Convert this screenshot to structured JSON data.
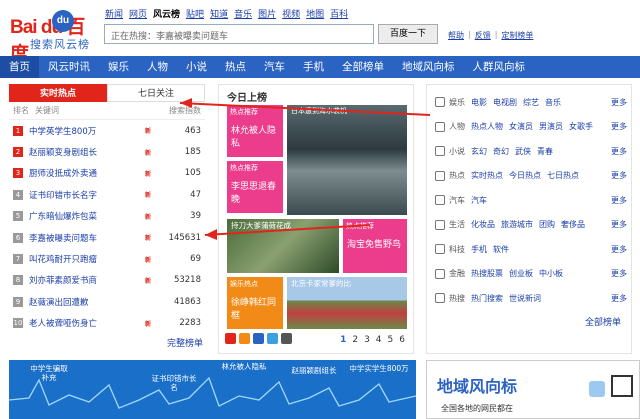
{
  "header": {
    "logo_text": "Bai du 百度",
    "logo_sub": "搜索风云榜",
    "logo_badge": "du",
    "top_links": [
      {
        "label": "新闻",
        "current": false
      },
      {
        "label": "网页",
        "current": false
      },
      {
        "label": "风云榜",
        "current": true
      },
      {
        "label": "贴吧",
        "current": false
      },
      {
        "label": "知道",
        "current": false
      },
      {
        "label": "音乐",
        "current": false
      },
      {
        "label": "图片",
        "current": false
      },
      {
        "label": "视频",
        "current": false
      },
      {
        "label": "地图",
        "current": false
      },
      {
        "label": "百科",
        "current": false
      }
    ],
    "search_value": "正在热搜：李嘉被曝卖问题车",
    "search_button": "百度一下",
    "help_links": [
      "帮助",
      "反馈",
      "定制榜单"
    ],
    "help_sep": "|"
  },
  "nav": {
    "items": [
      {
        "label": "首页",
        "active": true
      },
      {
        "label": "风云时讯",
        "active": false
      },
      {
        "label": "娱乐",
        "active": false
      },
      {
        "label": "人物",
        "active": false
      },
      {
        "label": "小说",
        "active": false
      },
      {
        "label": "热点",
        "active": false
      },
      {
        "label": "汽车",
        "active": false
      },
      {
        "label": "手机",
        "active": false
      },
      {
        "label": "全部榜单",
        "active": false
      },
      {
        "label": "地域风向标",
        "active": false
      },
      {
        "label": "人群风向标",
        "active": false
      }
    ]
  },
  "hot": {
    "tab_active": "实时热点",
    "tab_other": "七日关注",
    "col_rank": "排名",
    "col_keyword": "关键词",
    "col_index": "搜索指数",
    "new_badge": "新",
    "rows": [
      {
        "rank": "1",
        "kw": "中学英学生800万",
        "val": "463",
        "isnew": true
      },
      {
        "rank": "2",
        "kw": "赵丽颖变身剧组长",
        "val": "185",
        "isnew": true
      },
      {
        "rank": "3",
        "kw": "厨师没抵成外卖通",
        "val": "105",
        "isnew": true
      },
      {
        "rank": "4",
        "kw": "证书印错市长名字",
        "val": "47",
        "isnew": true
      },
      {
        "rank": "5",
        "kw": "广东暗仙爆炸包菜",
        "val": "39",
        "isnew": true
      },
      {
        "rank": "6",
        "kw": "李嘉被曝卖问题车",
        "val": "145631",
        "isnew": true
      },
      {
        "rank": "7",
        "kw": "叫花鸡耐开只跑瘤",
        "val": "69",
        "isnew": true
      },
      {
        "rank": "8",
        "kw": "刘亦菲素颜爱书商",
        "val": "53218",
        "isnew": true
      },
      {
        "rank": "9",
        "kw": "赵薇演出回遭歉",
        "val": "41863",
        "isnew": false
      },
      {
        "rank": "10",
        "kw": "老人被聋哑伤身亡",
        "val": "2283",
        "isnew": true
      }
    ],
    "more": "完整榜单"
  },
  "today": {
    "title": "今日上榜",
    "tiles": [
      {
        "cat": "热点推荐",
        "desc": "林允被人隐私"
      },
      {
        "cat": "热点推荐",
        "desc": "李思思退春晚"
      },
      {
        "cat": "热点推荐",
        "desc": "淘宝免售野鸟"
      },
      {
        "cat": "娱乐热点",
        "desc": "徐峥韩红同框"
      }
    ],
    "img_captions": [
      "日本遭到海水袭机",
      "持刀大爹蒲荷花成",
      "北京卡家常爹的比"
    ],
    "pages": [
      "1",
      "2",
      "3",
      "4",
      "5",
      "6"
    ],
    "current_page": "1"
  },
  "categories": {
    "rows": [
      {
        "label": "娱乐",
        "links": [
          "电影",
          "电视剧",
          "综艺",
          "音乐"
        ]
      },
      {
        "label": "人物",
        "links": [
          "热点人物",
          "女演员",
          "男演员",
          "女歌手"
        ]
      },
      {
        "label": "小说",
        "links": [
          "玄幻",
          "奇幻",
          "武侠",
          "青春"
        ]
      },
      {
        "label": "热点",
        "links": [
          "实时热点",
          "今日热点",
          "七日热点"
        ]
      },
      {
        "label": "汽车",
        "links": [
          "汽车"
        ]
      },
      {
        "label": "生活",
        "links": [
          "化妆品",
          "旅游城市",
          "团购",
          "奢侈品"
        ]
      },
      {
        "label": "科技",
        "links": [
          "手机",
          "软件"
        ]
      },
      {
        "label": "金融",
        "links": [
          "热搜股票",
          "创业板",
          "中小板"
        ]
      },
      {
        "label": "热搜",
        "links": [
          "热门搜索",
          "世说新词"
        ]
      }
    ],
    "row_more": "更多",
    "all": "全部榜单"
  },
  "bottom_left": {
    "labels": [
      "中学生骗取补充",
      "证书印错市长名",
      "林允被人隐私",
      "赵丽颖剧组长",
      "中学实学生800万"
    ]
  },
  "bottom_right": {
    "title": "地域风向标",
    "subtitle": "全国各地的网民都在"
  },
  "colors": {
    "brand_blue": "#2b63c2",
    "brand_red": "#e1251b",
    "pink": "#ec3c8c",
    "orange": "#f28a17"
  }
}
